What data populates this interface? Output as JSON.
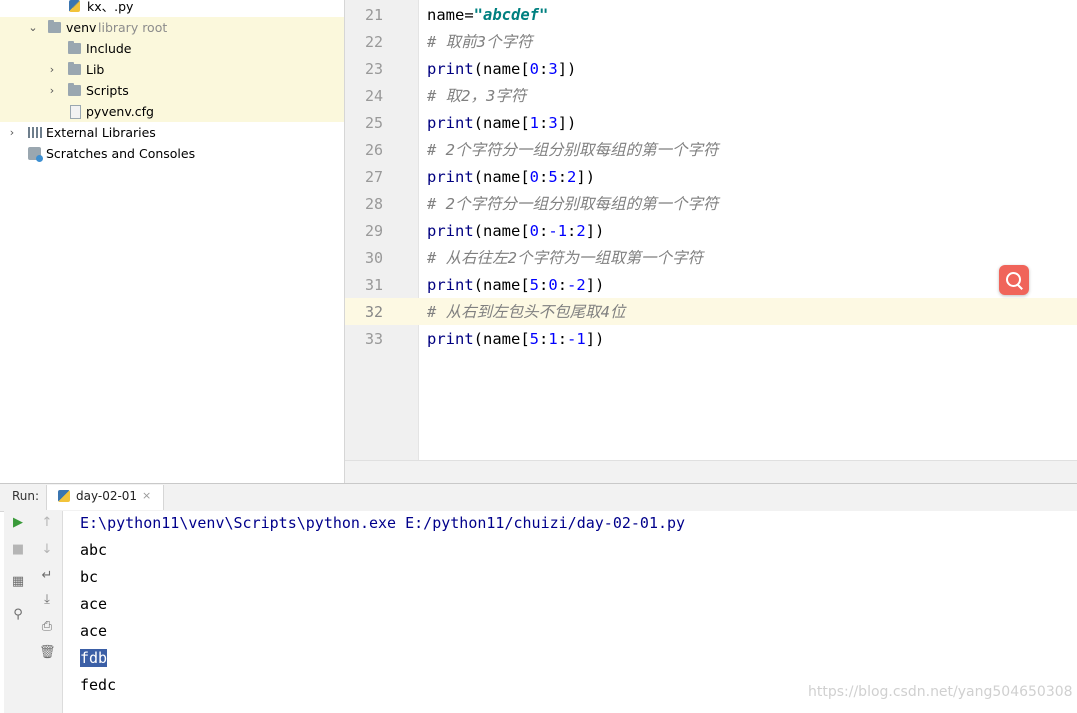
{
  "project_tree": {
    "items": [
      {
        "label": "kx、.py",
        "suffix": "",
        "icon": "python-file-icon"
      },
      {
        "label": "venv",
        "suffix": "library root",
        "icon": "folder-icon",
        "expanded": true
      },
      {
        "label": "Include",
        "suffix": "",
        "icon": "folder-icon"
      },
      {
        "label": "Lib",
        "suffix": "",
        "icon": "folder-icon",
        "expanded": false
      },
      {
        "label": "Scripts",
        "suffix": "",
        "icon": "folder-icon",
        "expanded": false
      },
      {
        "label": "pyvenv.cfg",
        "suffix": "",
        "icon": "config-file-icon"
      },
      {
        "label": "External Libraries",
        "suffix": "",
        "icon": "library-icon",
        "expanded": false
      },
      {
        "label": "Scratches and Consoles",
        "suffix": "",
        "icon": "scratch-icon"
      }
    ]
  },
  "editor": {
    "current_line": "32",
    "lines": [
      {
        "n": "21",
        "parts": [
          "name=",
          "\"abcdef\""
        ]
      },
      {
        "n": "22",
        "comment": "# 取前3个字符"
      },
      {
        "n": "23",
        "parts": [
          "print",
          "(name[",
          "0",
          ":",
          "3",
          "])"
        ]
      },
      {
        "n": "24",
        "comment": "# 取2，3字符"
      },
      {
        "n": "25",
        "parts": [
          "print",
          "(name[",
          "1",
          ":",
          "3",
          "])"
        ]
      },
      {
        "n": "26",
        "comment": "# 2个字符分一组分别取每组的第一个字符"
      },
      {
        "n": "27",
        "parts": [
          "print",
          "(name[",
          "0",
          ":",
          "5",
          ":",
          "2",
          "])"
        ]
      },
      {
        "n": "28",
        "comment": "# 2个字符分一组分别取每组的第一个字符"
      },
      {
        "n": "29",
        "parts": [
          "print",
          "(name[",
          "0",
          ":",
          "-1",
          ":",
          "2",
          "])"
        ]
      },
      {
        "n": "30",
        "comment": "# 从右往左2个字符为一组取第一个字符"
      },
      {
        "n": "31",
        "parts": [
          "print",
          "(name[",
          "5",
          ":",
          "0",
          ":",
          "-2",
          "])"
        ]
      },
      {
        "n": "32",
        "comment": "# 从右到左包头不包尾取4位"
      },
      {
        "n": "33",
        "parts": [
          "print",
          "(name[",
          "5",
          ":",
          "1",
          ":",
          "-1",
          "])"
        ]
      }
    ]
  },
  "run_panel": {
    "label": "Run:",
    "tab_label": "day-02-01",
    "tab_close": "×",
    "output": [
      "E:\\python11\\venv\\Scripts\\python.exe E:/python11/chuizi/day-02-01.py",
      "abc",
      "bc",
      "ace",
      "ace",
      "fdb",
      "fedc"
    ],
    "selected_output": "fdb"
  },
  "watermark": "https://blog.csdn.net/yang504650308",
  "colors": {
    "keyword": "#000080",
    "string": "#008080",
    "number": "#0000ff",
    "comment": "#808080",
    "search_button": "#f0645a",
    "selection": "#3b5fa6"
  }
}
